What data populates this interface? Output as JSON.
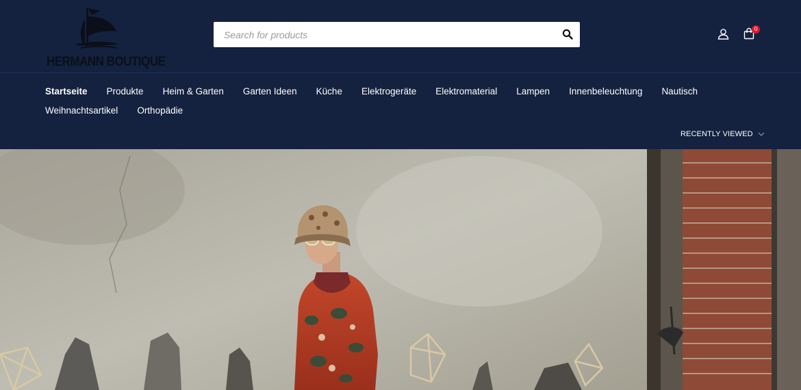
{
  "header": {
    "logo_text": "HERMANN BOUTIQUE",
    "background": "#14213f"
  },
  "search": {
    "placeholder": "Search for products",
    "value": "",
    "icon": "search-icon"
  },
  "account": {
    "icon": "user-icon"
  },
  "cart": {
    "icon": "shopping-bag-icon",
    "count": "0",
    "badge_color": "#e3162b"
  },
  "nav": {
    "row1": [
      {
        "label": "Startseite",
        "active": true
      },
      {
        "label": "Produkte"
      },
      {
        "label": "Heim & Garten"
      },
      {
        "label": "Garten Ideen"
      },
      {
        "label": "Küche"
      },
      {
        "label": "Elektrogeräte"
      },
      {
        "label": "Elektromaterial"
      },
      {
        "label": "Lampen"
      },
      {
        "label": "Innenbeleuchtung"
      },
      {
        "label": "Nautisch"
      }
    ],
    "row2": [
      {
        "label": "Weihnachtsartikel"
      },
      {
        "label": "Orthopädie"
      }
    ]
  },
  "recently_viewed": {
    "label": "RECENTLY VIEWED",
    "icon": "chevron-down-icon"
  },
  "hero": {
    "image": "fashion-model-photo"
  }
}
